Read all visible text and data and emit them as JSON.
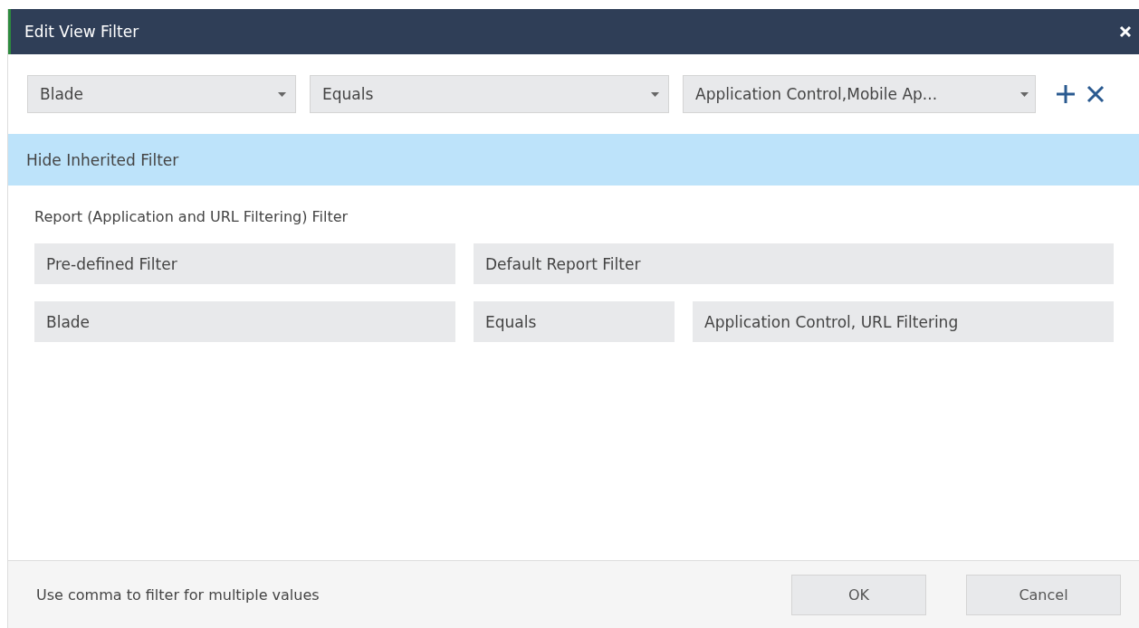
{
  "window": {
    "title": "Edit View Filter"
  },
  "filter_row": [
    {
      "kind": "dropdown",
      "value": "Blade"
    },
    {
      "kind": "dropdown",
      "value": "Equals"
    },
    {
      "kind": "dropdown",
      "value": "Application Control,Mobile Ap..."
    }
  ],
  "inherited_toggle": {
    "label": "Hide Inherited Filter"
  },
  "inherited": {
    "heading": "Report (Application and URL Filtering) Filter",
    "rows": [
      [
        "Pre-defined Filter",
        "Default Report Filter"
      ],
      [
        "Blade",
        "Equals",
        "Application Control, URL Filtering"
      ]
    ]
  },
  "footer": {
    "hint": "Use comma to filter for multiple values",
    "buttons": [
      "OK",
      "Cancel"
    ]
  }
}
